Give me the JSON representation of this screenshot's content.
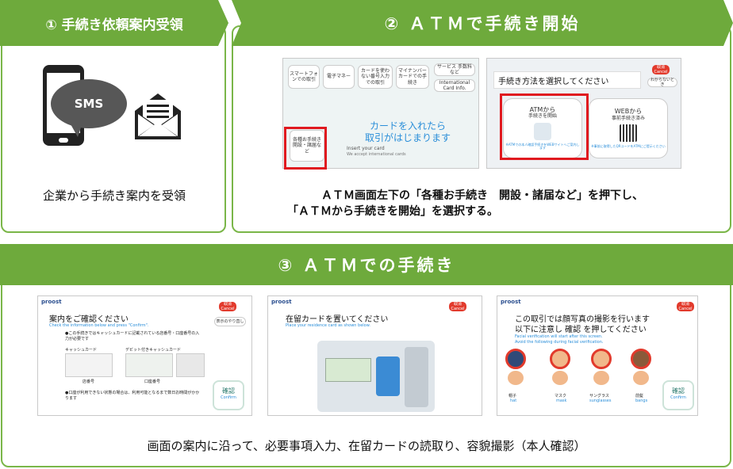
{
  "step1": {
    "header": "① 手続き依頼案内受領",
    "sms_label": "SMS",
    "caption": "企業から手続き案内を受領"
  },
  "step2": {
    "header": "② ＡＴＭで手続き開始",
    "caption_line1": "ＡＴＭ画面左下の「各種お手続き　開設・諸届など」を押下し、",
    "caption_line2": "「ＡＴＭから手続きを開始」を選択する。",
    "screen1": {
      "menu": [
        "スマートフォンでの取引",
        "電子マネー",
        "カードを使わない番号入力での取引",
        "マイナンバーカードでの手続き"
      ],
      "service": "サービス 手数料 など",
      "intl": "International Card Info.",
      "procedure": "各種お手続き 開設・諸届など",
      "main_line1": "カードを入れたら",
      "main_line2": "取引がはじまります",
      "insert_en": "Insert your card",
      "insert_sub": "We accept international cards"
    },
    "screen2": {
      "title": "手続き方法を選択してください",
      "cancel": "取消",
      "cancel_en": "Cancel",
      "help": "わからないとき",
      "atm_option_line1": "ATMから",
      "atm_option_line2": "手続きを開始",
      "atm_option_note": "※ATMでの本人確認手続きをWEBサイトへご案内します",
      "web_option_line1": "WEBから",
      "web_option_line2": "事前手続き済み",
      "web_option_note": "※事前に取得したQRコードをATMにご提示ください"
    }
  },
  "step3": {
    "header": "③ ＡＴＭでの手続き",
    "caption": "画面の案内に沿って、必要事項入力、在留カードの読取り、容貌撮影（本人確認）",
    "brand": "proost",
    "cancel": "取消",
    "cancel_en": "Cancel",
    "confirm": "確認",
    "confirm_en": "Confirm",
    "screen_a": {
      "title": "案内をご確認ください",
      "sub": "Check the information below and press \"Confirm\".",
      "help": "表示のやり直し",
      "bullet1": "●この手続きではキャッシュカードに記載されている店番号・口座番号の入力が必要です",
      "label1": "キャッシュカード",
      "label2": "デビット付きキャッシュカード",
      "branch": "店番号",
      "account": "口座番号",
      "bullet2": "●口座が利用できない状態の場合は、利用可能となるまで数日お時間がかかります"
    },
    "screen_b": {
      "title": "在留カードを置いてください",
      "sub": "Place your residence card as shown below."
    },
    "screen_c": {
      "title_line1": "この取引では顔写真の撮影を行います",
      "title_line2": "以下に注意し 確認 を押してください",
      "sub1": "Facial verification will start after this screen.",
      "sub2": "Avoid the following during facial verification.",
      "items": [
        {
          "jp": "帽子",
          "en": "hat"
        },
        {
          "jp": "マスク",
          "en": "mask"
        },
        {
          "jp": "サングラス",
          "en": "sunglasses"
        },
        {
          "jp": "前髪",
          "en": "bangs"
        }
      ]
    }
  },
  "colors": {
    "header_green": "#6eaa3c",
    "border_green": "#7ab648",
    "highlight_red": "#e0191f",
    "screen_blue": "#2a8ed9"
  }
}
